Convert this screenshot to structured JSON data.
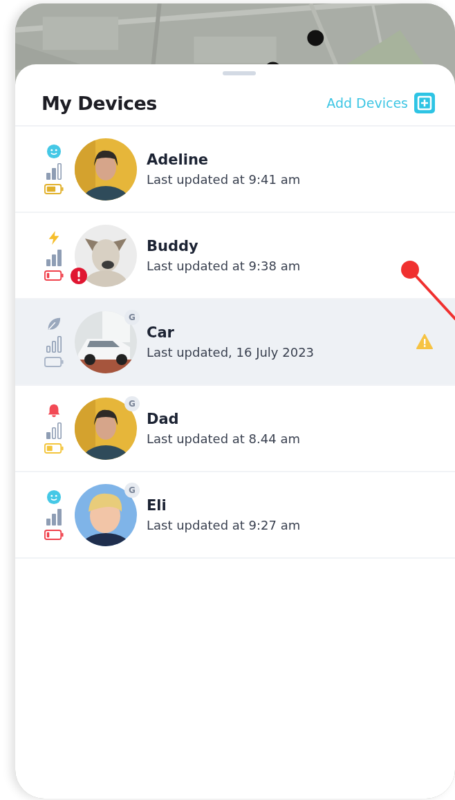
{
  "header": {
    "title": "My Devices",
    "add_button": "Add Devices"
  },
  "devices": [
    {
      "name": "Adeline",
      "updated": "Last updated at 9:41 am",
      "status": {
        "kind": "smile"
      },
      "signal": {
        "kind": "medium"
      },
      "battery": {
        "kind": "high"
      },
      "avatar": {
        "kind": "person"
      },
      "selected": false,
      "warning": false
    },
    {
      "name": "Buddy",
      "updated": "Last updated at 9:38 am",
      "status": {
        "kind": "bolt"
      },
      "signal": {
        "kind": "full"
      },
      "battery": {
        "kind": "low"
      },
      "avatar": {
        "kind": "dog"
      },
      "badge": {
        "kind": "alert"
      },
      "selected": false,
      "warning": false
    },
    {
      "name": "Car",
      "updated": "Last updated, 16 July 2023",
      "status": {
        "kind": "leaf"
      },
      "signal": {
        "kind": "none"
      },
      "battery": {
        "kind": "empty"
      },
      "avatar": {
        "kind": "car"
      },
      "badge": {
        "kind": "letter",
        "text": "G"
      },
      "selected": true,
      "warning": true
    },
    {
      "name": "Dad",
      "updated": "Last updated at 8.44 am",
      "status": {
        "kind": "bell"
      },
      "signal": {
        "kind": "low"
      },
      "battery": {
        "kind": "medium"
      },
      "avatar": {
        "kind": "person"
      },
      "badge": {
        "kind": "letter",
        "text": "G"
      },
      "selected": false,
      "warning": false
    },
    {
      "name": "Eli",
      "updated": "Last updated at 9:27 am",
      "status": {
        "kind": "smile"
      },
      "signal": {
        "kind": "full"
      },
      "battery": {
        "kind": "low"
      },
      "avatar": {
        "kind": "child"
      },
      "badge": {
        "kind": "letter",
        "text": "G"
      },
      "selected": false,
      "warning": false
    }
  ]
}
